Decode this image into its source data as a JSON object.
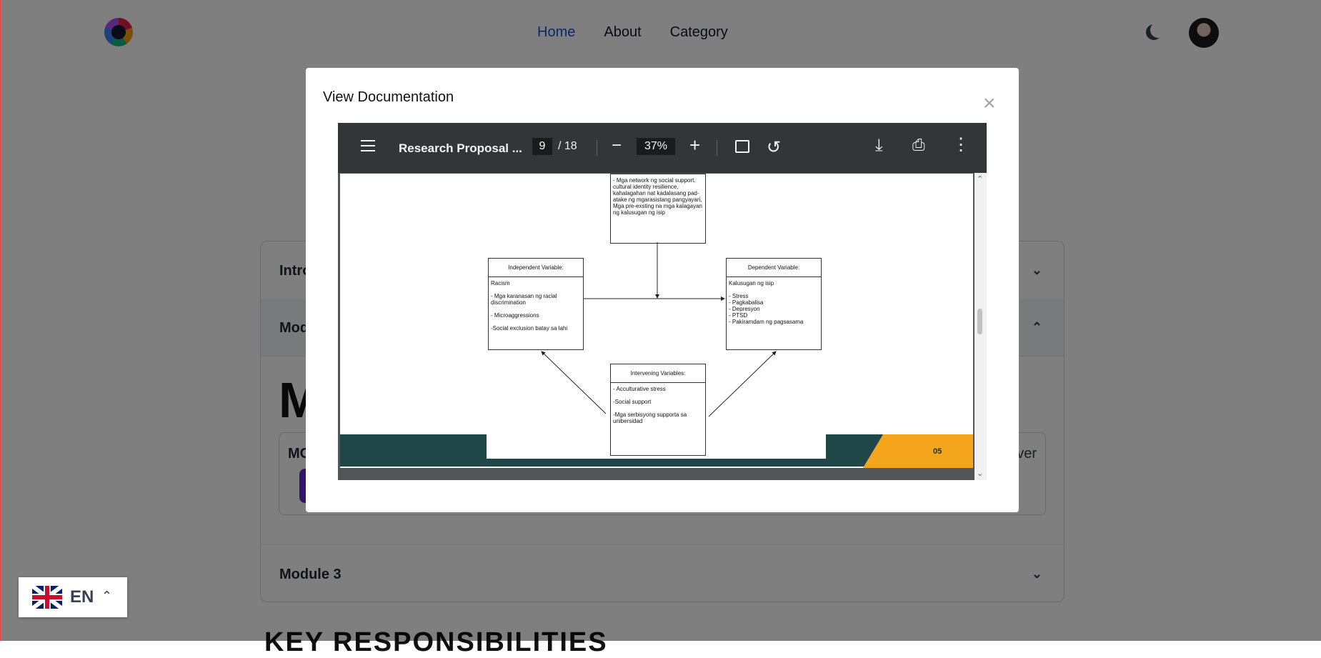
{
  "nav": {
    "links": [
      "Home",
      "About",
      "Category"
    ]
  },
  "accordion": {
    "row1_label": "Intro",
    "row2_label": "Mod",
    "row3_label": "Module 3",
    "big_letter": "M",
    "card_title": "MC",
    "card_right": "ver",
    "bottom_heading": "KEY RESPONSIBILITIES"
  },
  "modal": {
    "title": "View Documentation",
    "close_symbol": "×"
  },
  "pdf_viewer": {
    "doc_title": "Research Proposal ...",
    "current_page": "9",
    "total_pages": "/ 18",
    "zoom": "37%"
  },
  "pdf_content": {
    "top_box_text": "- Mga network ng social support.\ncultural identity resilience,\nkahalagahan nat kadalasang pad-\natake ng mgarasistang pangyayari,\nMga pre-exsting na mga kalagayan\nng kalusugan ng isip",
    "independent_header": "Independent Variable:",
    "independent_text": "Racism\n\n    - Mga karanasan ng racial\n      discrimination\n\n    - Microaggressions\n\n    -Social exclusion batay sa lahi",
    "dependent_header": "Dependent Variable:",
    "dependent_text": "Kalusugan ng isip\n\n     - Stress\n     - Pagkabalisa\n     - Depresyon\n     - PTSD\n     - Pakiramdam ng pagsasama",
    "intervening_header": "Intervening Variables:",
    "intervening_text": "- Acculturative stress\n\n-Social support\n\n-Mga serbisyong supporta sa\nunibersidad",
    "page_number": "05"
  },
  "language": {
    "code": "EN"
  }
}
